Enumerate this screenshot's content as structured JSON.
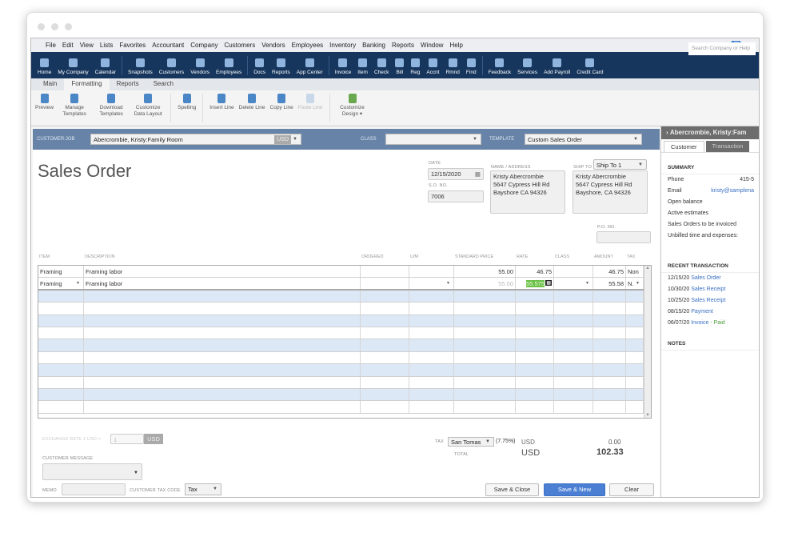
{
  "menu": [
    "File",
    "Edit",
    "View",
    "Lists",
    "Favorites",
    "Accountant",
    "Company",
    "Customers",
    "Vendors",
    "Employees",
    "Inventory",
    "Banking",
    "Reports",
    "Window",
    "Help"
  ],
  "reminder_count": "28",
  "iconbar": [
    "Home",
    "My Company",
    "Calendar",
    "Snapshots",
    "Customers",
    "Vendors",
    "Employees",
    "Docs",
    "Reports",
    "App Center",
    "Invoice",
    "Item",
    "Check",
    "Bill",
    "Reg",
    "Accnt",
    "Rmnd",
    "Find",
    "Feedback",
    "Services",
    "Add Payroll",
    "Credit Card"
  ],
  "search_placeholder": "Search Company or Help",
  "ribbon_tabs": [
    "Main",
    "Formatting",
    "Reports",
    "Search"
  ],
  "ribbon": [
    {
      "label": "Preview"
    },
    {
      "label": "Manage Templates"
    },
    {
      "label": "Download Templates"
    },
    {
      "label": "Customize Data Layout"
    },
    {
      "label": "Spelling"
    },
    {
      "label": "Insert Line"
    },
    {
      "label": "Delete Line"
    },
    {
      "label": "Copy Line"
    },
    {
      "label": "Paste Line"
    },
    {
      "label": "Customize Design ▾"
    }
  ],
  "header": {
    "customer_job_label": "CUSTOMER:JOB",
    "customer_job": "Abercrombie, Kristy:Family Room",
    "currency": "USD",
    "class_label": "CLASS",
    "class_value": "",
    "template_label": "TEMPLATE",
    "template": "Custom Sales Order"
  },
  "form": {
    "title": "Sales Order",
    "date_label": "DATE",
    "date": "12/15/2020",
    "so_label": "S.O. NO.",
    "so_no": "7006",
    "name_label": "NAME / ADDRESS",
    "name_address": [
      "Kristy Abercrombie",
      "5647 Cypress Hill Rd",
      "Bayshore CA 94326"
    ],
    "ship_label": "SHIP TO",
    "ship_select": "Ship To 1",
    "ship_address": [
      "Kristy Abercrombie",
      "5647 Cypress Hill Rd",
      "Bayshore, CA 94326"
    ],
    "po_label": "P.O. NO.",
    "po_no": ""
  },
  "grid": {
    "columns": [
      "ITEM",
      "DESCRIPTION",
      "ORDERED",
      "U/M",
      "STANDARD PRICE",
      "RATE",
      "CLASS",
      "AMOUNT",
      "TAX"
    ],
    "rows": [
      {
        "item": "Framing",
        "description": "Framing labor",
        "ordered": "",
        "um": "",
        "std_price": "55.00",
        "rate": "46.75",
        "class": "",
        "amount": "46.75",
        "tax": "Non"
      },
      {
        "item": "Framing",
        "description": "Framing labor",
        "ordered": "",
        "um": "",
        "std_price": "55.00",
        "rate": "55.575",
        "class": "",
        "amount": "55.58",
        "tax": "N."
      }
    ]
  },
  "footer": {
    "exchange_label": "EXCHANGE RATE 1 USD =",
    "exchange_value": "1",
    "exchange_currency": "USD",
    "customer_message_label": "CUSTOMER MESSAGE",
    "memo_label": "MEMO",
    "tax_code_label": "CUSTOMER TAX CODE",
    "tax_code": "Tax",
    "tax_label": "TAX",
    "tax_item": "San Tomas",
    "tax_rate": "(7.75%)",
    "tax_currency": "USD",
    "tax_amount": "0.00",
    "total_label": "TOTAL",
    "total_currency": "USD",
    "total": "102.33",
    "save_close": "Save & Close",
    "save_new": "Save & New",
    "clear": "Clear"
  },
  "side": {
    "title": "Abercrombie, Kristy:Fam",
    "tabs": [
      "Customer",
      "Transaction"
    ],
    "summary_label": "SUMMARY",
    "phone_label": "Phone",
    "phone": "415-5",
    "email_label": "Email",
    "email": "kristy@samplena",
    "summary_items": [
      "Open balance",
      "Active estimates",
      "Sales Orders to be invoiced",
      "Unbilled time and expenses:"
    ],
    "recent_label": "RECENT TRANSACTION",
    "recent": [
      {
        "date": "12/15/20",
        "type": "Sales Order",
        "status": ""
      },
      {
        "date": "10/30/20",
        "type": "Sales Receipt",
        "status": ""
      },
      {
        "date": "10/25/20",
        "type": "Sales Receipt",
        "status": ""
      },
      {
        "date": "08/15/20",
        "type": "Payment",
        "status": ""
      },
      {
        "date": "06/07/20",
        "type": "Invoice",
        "status": "- Paid"
      }
    ],
    "notes_label": "NOTES"
  },
  "colors": {
    "navy": "#17365d",
    "header_blue": "#6783a8",
    "stripe": "#dce8f6",
    "highlight": "#6cc04a",
    "primary_button": "#4a7fd4"
  }
}
